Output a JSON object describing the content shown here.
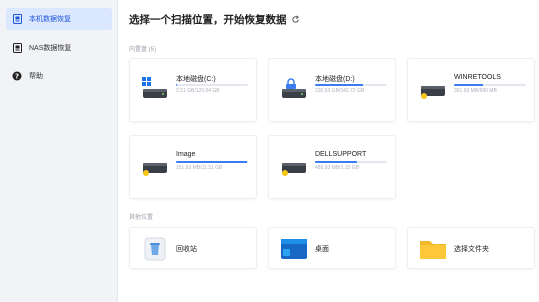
{
  "sidebar": {
    "items": [
      {
        "label": "本机数据恢复",
        "icon": "local-recovery-icon",
        "active": true
      },
      {
        "label": "NAS数据恢复",
        "icon": "nas-recovery-icon",
        "active": false
      },
      {
        "label": "帮助",
        "icon": "help-icon",
        "active": false
      }
    ]
  },
  "main": {
    "title": "选择一个扫描位置，开始恢复数据",
    "internal_label": "内置盘 (5)",
    "other_label": "其他位置",
    "drives": [
      {
        "name": "本地磁盘(C:)",
        "size": "2.51 GB/120.04 GB",
        "usage": 0.02,
        "windows": true
      },
      {
        "name": "本地磁盘(D:)",
        "size": "230.53 GB/342.72 GB",
        "usage": 0.67,
        "windows": false
      },
      {
        "name": "WINRETOOLS",
        "size": "391.93 MB/990 MB",
        "usage": 0.4,
        "windows": false
      },
      {
        "name": "Image",
        "size": "151.93 MB/11.31 GB",
        "usage": 0.99,
        "windows": false
      },
      {
        "name": "DELLSUPPORT",
        "size": "489.93 MB/1.15 GB",
        "usage": 0.58,
        "windows": false
      }
    ],
    "locations": [
      {
        "name": "回收站",
        "icon": "recycle-bin-icon"
      },
      {
        "name": "桌面",
        "icon": "desktop-icon"
      },
      {
        "name": "选择文件夹",
        "icon": "folder-icon"
      }
    ]
  },
  "colors": {
    "accent": "#3c7cf2",
    "sidebar_bg": "#f1f3f7",
    "active_bg": "#dbe6ff"
  }
}
